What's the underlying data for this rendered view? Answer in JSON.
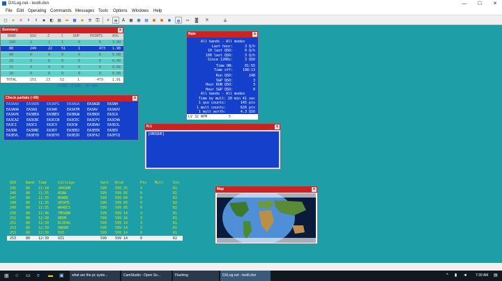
{
  "window": {
    "title": "DXLog.net - test6.dxn",
    "min": "—",
    "max": "☐",
    "close": "✕"
  },
  "menu": [
    "File",
    "Edit",
    "Operating",
    "Commands",
    "Messages",
    "Tools",
    "Options",
    "Windows",
    "Help"
  ],
  "summary": {
    "title": "Summary",
    "headers": [
      "BAND",
      "QSO",
      "Z",
      "C",
      "DUP",
      "POINTS",
      "AVG"
    ],
    "rows": [
      [
        "160",
        "2",
        "1",
        "1",
        "0",
        "6",
        "3.00"
      ],
      [
        "80",
        "249",
        "22",
        "51",
        "1",
        "473",
        "1.90"
      ],
      [
        "40",
        "0",
        "0",
        "0",
        "0",
        "0",
        "0.00"
      ],
      [
        "20",
        "0",
        "0",
        "0",
        "0",
        "0",
        "0.00"
      ],
      [
        "15",
        "0",
        "0",
        "0",
        "0",
        "0",
        "0.00"
      ],
      [
        "10",
        "0",
        "0",
        "0",
        "0",
        "0",
        "0.00"
      ]
    ],
    "total": [
      "TOTAL",
      "251",
      "23",
      "52",
      "1",
      "479",
      "1.91"
    ],
    "final_score": "FINAL SCORE: 36 404"
  },
  "check_partials": {
    "title": "Check partials (~69)",
    "rows": [
      [
        "EA3AAO",
        "EA3ADR",
        "EA3AFG",
        "EA3AGA",
        "EA3AGB",
        "EA3AH"
      ],
      [
        "EA3AHA",
        "EA3AQ",
        "EA3AR",
        "EA3ATM",
        "EA3AV",
        "EA3AVV"
      ],
      [
        "EA3AYK",
        "EA3BEA",
        "EA3BEX",
        "EA3BGW",
        "EA3BOX",
        "EA3CA"
      ],
      [
        "EA3CAZ",
        "EA3CBC",
        "EA3CCN",
        "EA3CEC",
        "EA3CFV",
        "EA3CHA"
      ],
      [
        "EA3CI",
        "EA3CS",
        "EA3CV",
        "EA3CW",
        "EA3DAU",
        "EA3DJL"
      ],
      [
        "EA3DN",
        "EA3DNC",
        "EA3DY",
        "EA3EBJ",
        "EA3EER",
        "EA3EO"
      ],
      [
        "EA3EVL",
        "EA3EYD",
        "EA3EYO",
        "EA3EZD",
        "EA3FAJ",
        "EA3FCQ"
      ]
    ]
  },
  "rate": {
    "title": "Rate",
    "sec1_header": "All bands - All modes",
    "sec1": [
      [
        "Last hour:",
        "3 Q/h"
      ],
      [
        "10 last QSO:",
        "0 Q/h"
      ],
      [
        "100 last QSO:",
        "3 Q/h"
      ],
      [
        "Since 1200z:",
        "3 QSO"
      ],
      [
        "Time ON:",
        "01:55"
      ],
      [
        "Time off:",
        "108:13"
      ],
      [
        "Run QSO:",
        "248"
      ],
      [
        "S&P QSO:",
        "3"
      ],
      [
        "Hour RUN QSO:",
        "3"
      ],
      [
        "Hour S&P QSO:",
        "0"
      ]
    ],
    "sec2_header": "All bands - All modes",
    "sec2": [
      [
        "Time by mult:",
        "20 min 41 sec"
      ],
      [
        "1 qso counts:",
        "145 pts"
      ],
      [
        "1 mult counts:",
        "626 pts"
      ],
      [
        "1 mult worth:",
        "4.3 QSO"
      ]
    ],
    "wpm": "LV 32 WPM",
    "wpm_right": "5"
  },
  "n1": {
    "title": "N-1",
    "value": "[UNIQUE]"
  },
  "log": {
    "headers": [
      "QSO",
      "Band",
      "Time",
      "Callsign",
      "Sent",
      "Rcvd",
      "Pts",
      "Mult",
      "Stn"
    ],
    "rows": [
      [
        "245",
        "80",
        "11:34",
        "JH4SDM",
        "599",
        "599 25",
        "3",
        "",
        "R1"
      ],
      [
        "246",
        "80",
        "11:35",
        "N1NA",
        "599",
        "599 05",
        "0",
        "",
        "R1"
      ],
      [
        "247",
        "80",
        "11:35",
        "W5WRE",
        "599",
        "599 04",
        "0",
        "",
        "R2"
      ],
      [
        "248",
        "80",
        "11:35",
        "OE5HTL",
        "599",
        "599 05",
        "0",
        "",
        "R2"
      ],
      [
        "249",
        "80",
        "11:35",
        "WA4DCS",
        "599",
        "599 05",
        "0",
        "",
        "R2"
      ],
      [
        "250",
        "80",
        "11:36",
        "TM5GBW",
        "599",
        "599 14",
        "3",
        "",
        "R1"
      ],
      [
        "251",
        "80",
        "12:38",
        "RM3M",
        "599",
        "599 16",
        "3",
        "",
        "R1"
      ],
      [
        "252",
        "80",
        "12:39",
        "DL5EAG",
        "599",
        "599 14",
        "3",
        "",
        "R1"
      ],
      [
        "253",
        "80",
        "12:39",
        "ON6DR",
        "599",
        "599 14",
        "3",
        "",
        "R1"
      ],
      [
        "253",
        "80",
        "12:39",
        "EA3",
        "599",
        "599 14",
        "0",
        "",
        "R1"
      ],
      [
        "253",
        "80",
        "12:39",
        "OZ1",
        "599",
        "599 14",
        "0",
        "",
        "R2"
      ]
    ]
  },
  "map": {
    "title": "Map"
  },
  "taskbar": {
    "search": "what are the pc syste...",
    "apps": [
      "CamStudio - Open So...",
      "Flashing",
      "DXLog.net - test6.dxn"
    ],
    "time": "7:39 AM"
  },
  "colors": {
    "desktop": "#1e9ea6",
    "title_red": "#cc2222",
    "panel_blue": "#1540cc",
    "log_yellow": "#e8e800"
  }
}
